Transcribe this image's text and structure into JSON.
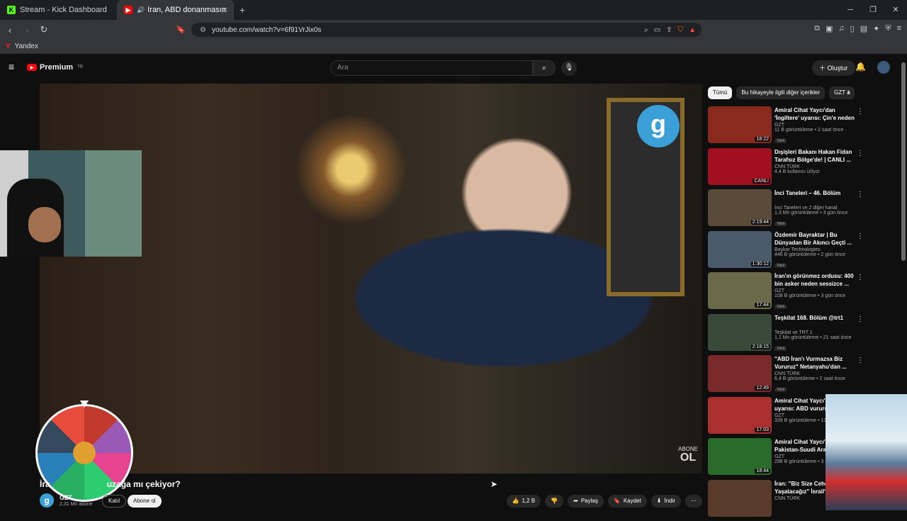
{
  "browser": {
    "tabs": [
      {
        "label": "Stream - Kick Dashboard",
        "favicon": "K",
        "favicon_color": "#53fc18"
      },
      {
        "label": "İran, ABD donanmasını tuzağ",
        "favicon": "▶",
        "favicon_color": "#ff0000"
      }
    ],
    "url": "youtube.com/watch?v=6f91VrJix0s",
    "bookmark": "Yandex"
  },
  "youtube": {
    "logo_text": "Premium",
    "logo_region": "TR",
    "search_placeholder": "Ara",
    "create_label": "Oluştur"
  },
  "video": {
    "title": "İran, ABD donanmasını tuzağa mı çekiyor?",
    "title_visible_left": "İra",
    "title_visible_right": "uzağa mı çekiyor?",
    "overlay_abone": "ABONE",
    "overlay_ol": "OL",
    "channel_logo_letter": "g",
    "channel_name": "GZT",
    "subscribers": "2,31 Mn abone",
    "join_label": "Katıl",
    "subscribe_label": "Abone ol",
    "likes": "1,2 B",
    "share_label": "Paylaş",
    "save_label": "Kaydet",
    "download_label": "İndir"
  },
  "chips": [
    "Tümü",
    "Bu hikayeyle ilgili diğer içerikler",
    "GZT a"
  ],
  "related": [
    {
      "title": "Amiral Cihat Yaycı'dan 'İngiltere' uyarısı: Çin'e neden izin verdi?",
      "channel": "GZT",
      "meta": "11 B görüntüleme • 2 saat önce",
      "badge": "Yeni",
      "duration": "18:22",
      "thumb_color": "#8a2a1e"
    },
    {
      "title": "Dışişleri Bakanı Hakan Fidan Tarafsız Bölge'de! | CANLI ...",
      "channel": "CNN TÜRK",
      "meta": "4,4 B kullanıcı izliyor",
      "badge": "",
      "duration": "CANLI",
      "thumb_color": "#a01020"
    },
    {
      "title": "İnci Taneleri – 46. Bölüm",
      "channel": "İnci Taneleri ve 2 diğer kanal",
      "meta": "1,3 Mn görüntüleme • 3 gün önce",
      "badge": "Yeni",
      "duration": "2:19:44",
      "thumb_color": "#5a4a3a"
    },
    {
      "title": "Özdemir Bayraktar | Bu Dünyadan Bir Akıncı Geçti ...",
      "channel": "Baykar Technologies",
      "meta": "446 B görüntüleme • 2 gün önce",
      "badge": "Yeni",
      "duration": "1:30:12",
      "thumb_color": "#4a5a6a"
    },
    {
      "title": "İran'ın görünmez ordusu: 400 bin asker neden sessizce ...",
      "channel": "GZT",
      "meta": "108 B görüntüleme • 3 gün önce",
      "badge": "Yeni",
      "duration": "17:44",
      "thumb_color": "#6a6a4a"
    },
    {
      "title": "Teşkilat 168. Bölüm @trt1",
      "channel": "Teşkilat ve TRT 1",
      "meta": "1,1 Mn görüntüleme • 21 saat önce",
      "badge": "Yeni",
      "duration": "2:18:15",
      "thumb_color": "#3a4a3a"
    },
    {
      "title": "\"ABD İran'ı Vurmazsa Biz Vururuz\" Netanyahu'dan ...",
      "channel": "CNN TÜRK",
      "meta": "6,4 B görüntüleme • 2 saat önce",
      "badge": "Yeni",
      "duration": "12:49",
      "thumb_color": "#7a2a2a"
    },
    {
      "title": "Amiral Cihat Yaycı'dan uyarısı: ABD vurursa",
      "channel": "GZT",
      "meta": "339 B görüntüleme • 13",
      "badge": "",
      "duration": "17:03",
      "thumb_color": "#aa3030"
    },
    {
      "title": "Amiral Cihat Yaycı'dan Pakistan-Suudi Arabi",
      "channel": "GZT",
      "meta": "296 B görüntüleme • 3",
      "badge": "",
      "duration": "18:44",
      "thumb_color": "#2a6a2a"
    },
    {
      "title": "İran: \"Biz Size Cehenn Yaşatacağız\" İsrail'in",
      "channel": "CNN TÜRK",
      "meta": "",
      "badge": "",
      "duration": "",
      "thumb_color": "#5a3a2a"
    }
  ]
}
